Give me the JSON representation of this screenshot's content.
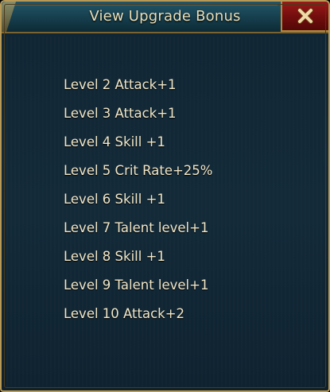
{
  "window": {
    "title": "View Upgrade Bonus",
    "close_label": "✕"
  },
  "bonuses": [
    "Level 2 Attack+1",
    "Level 3 Attack+1",
    "Level 4 Skill +1",
    "Level 5 Crit Rate+25%",
    "Level 6 Skill +1",
    "Level 7 Talent level+1",
    "Level 8 Skill +1",
    "Level 9 Talent level+1",
    "Level 10 Attack+2"
  ],
  "colors": {
    "title_text": "#e9dfb8",
    "item_text": "#f1e7c8",
    "panel_bg": "#132a39",
    "frame_gold": "#b89a56",
    "close_red": "#8a1414"
  },
  "icons": {
    "close": "close-icon"
  }
}
